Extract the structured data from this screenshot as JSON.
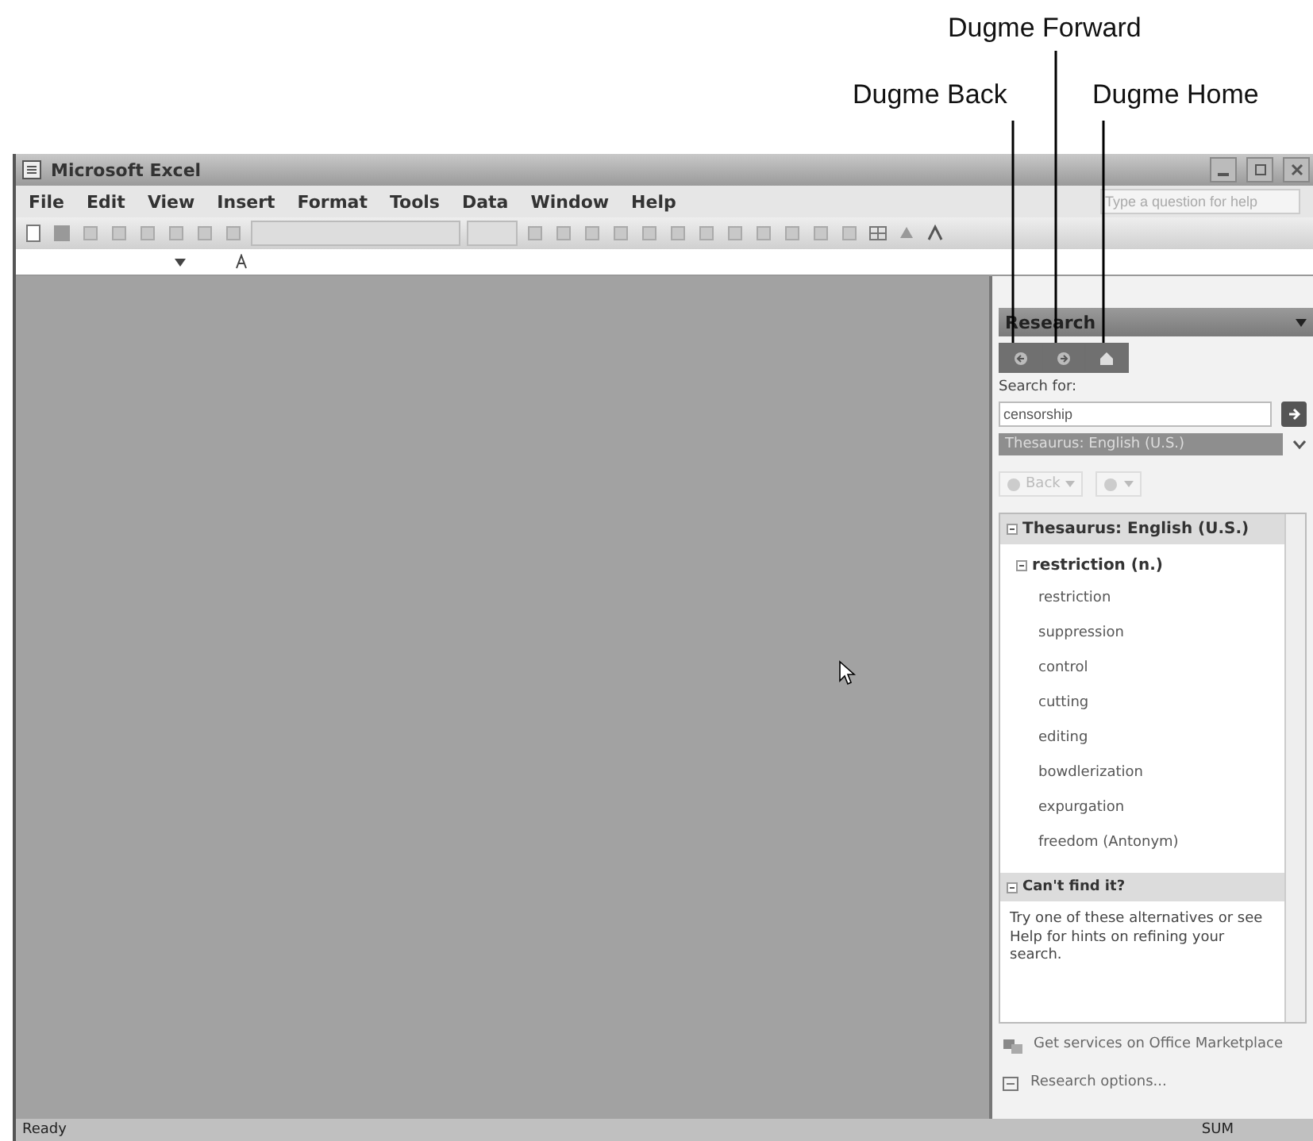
{
  "callouts": [
    {
      "kind": "forward",
      "label": "Dugme Forward"
    },
    {
      "kind": "back",
      "label": "Dugme Back"
    },
    {
      "kind": "home",
      "label": "Dugme Home"
    }
  ],
  "window": {
    "title": "Microsoft Excel"
  },
  "menu": [
    "File",
    "Edit",
    "View",
    "Insert",
    "Format",
    "Tools",
    "Data",
    "Window",
    "Help"
  ],
  "help_box": {
    "placeholder": "Type a question for help"
  },
  "task_pane": {
    "title": "Research",
    "search_label": "Search for:",
    "search_value": "censorship",
    "source": "Thesaurus: English (U.S.)",
    "back_label": "Back",
    "results": {
      "heading": "Thesaurus: English (U.S.)",
      "entry": "restriction (n.)",
      "expanded": true,
      "words": [
        "restriction",
        "suppression",
        "control",
        "cutting",
        "editing",
        "bowdlerization",
        "expurgation",
        "freedom (Antonym)"
      ]
    },
    "cant_find": {
      "heading": "Can't find it?",
      "text": "Try one of these alternatives or see Help for hints on refining your search."
    },
    "links": [
      "Get services on Office Marketplace",
      "Research options..."
    ]
  },
  "status_bar": {
    "left": "Ready",
    "sum": "SUM"
  }
}
